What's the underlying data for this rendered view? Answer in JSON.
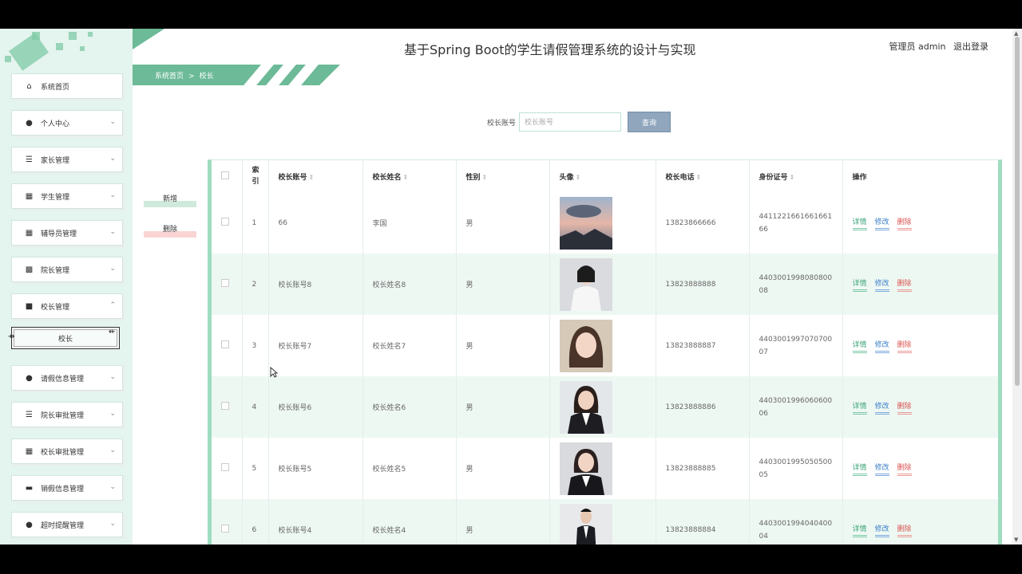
{
  "header": {
    "title": "基于Spring Boot的学生请假管理系统的设计与实现",
    "user": "管理员 admin",
    "logout": "退出登录"
  },
  "breadcrumb": {
    "home": "系统首页",
    "sep": ">",
    "current": "校长"
  },
  "search": {
    "label": "校长账号",
    "placeholder": "校长账号",
    "value": "",
    "button": "查询"
  },
  "actions": {
    "add": "新增",
    "delete": "删除"
  },
  "sidebar": {
    "items": [
      {
        "label": "系统首页",
        "icon": "home-icon",
        "chevron": ""
      },
      {
        "label": "个人中心",
        "icon": "user-icon",
        "chevron": "⌄"
      },
      {
        "label": "家长管理",
        "icon": "list-icon",
        "chevron": "⌄"
      },
      {
        "label": "学生管理",
        "icon": "grid-icon",
        "chevron": "⌄"
      },
      {
        "label": "辅导员管理",
        "icon": "grid-icon",
        "chevron": "⌄"
      },
      {
        "label": "院长管理",
        "icon": "grid9-icon",
        "chevron": "⌄"
      },
      {
        "label": "校长管理",
        "icon": "briefcase-icon",
        "chevron": "⌃"
      },
      {
        "label": "请假信息管理",
        "icon": "pin-icon",
        "chevron": "⌄"
      },
      {
        "label": "院长审批管理",
        "icon": "list-icon",
        "chevron": "⌄"
      },
      {
        "label": "校长审批管理",
        "icon": "grid-icon",
        "chevron": "⌄"
      },
      {
        "label": "销假信息管理",
        "icon": "device-icon",
        "chevron": "⌄"
      },
      {
        "label": "超时提醒管理",
        "icon": "user-icon",
        "chevron": "⌄"
      }
    ],
    "sub_item": "校长"
  },
  "table": {
    "headers": [
      "",
      "索引",
      "校长账号",
      "校长姓名",
      "性别",
      "头像",
      "校长电话",
      "身份证号",
      "操作"
    ],
    "ops": {
      "detail": "详情",
      "edit": "修改",
      "delete": "删除"
    },
    "rows": [
      {
        "index": "1",
        "account": "66",
        "name": "李国",
        "gender": "男",
        "avatar": "landscape",
        "phone": "13823866666",
        "idcard": "441122166166166166"
      },
      {
        "index": "2",
        "account": "校长账号8",
        "name": "校长姓名8",
        "gender": "男",
        "avatar": "woman-white",
        "phone": "13823888888",
        "idcard": "440300199808080008"
      },
      {
        "index": "3",
        "account": "校长账号7",
        "name": "校长姓名7",
        "gender": "男",
        "avatar": "woman-face",
        "phone": "13823888887",
        "idcard": "440300199707070007"
      },
      {
        "index": "4",
        "account": "校长账号6",
        "name": "校长姓名6",
        "gender": "男",
        "avatar": "woman-suit",
        "phone": "13823888886",
        "idcard": "440300199606060006"
      },
      {
        "index": "5",
        "account": "校长账号5",
        "name": "校长姓名5",
        "gender": "男",
        "avatar": "woman-suit2",
        "phone": "13823888885",
        "idcard": "440300199505050005"
      },
      {
        "index": "6",
        "account": "校长账号4",
        "name": "校长姓名4",
        "gender": "男",
        "avatar": "man-suit",
        "phone": "13823888884",
        "idcard": "440300199404040004"
      }
    ]
  },
  "colors": {
    "accent": "#6cba97",
    "sidebar_bg": "#e4f4ee",
    "row_alt": "#eef8f3",
    "search_btn": "#8fa6bd"
  }
}
